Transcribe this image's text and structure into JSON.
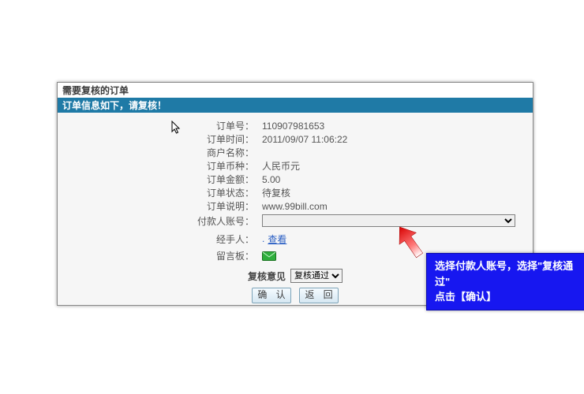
{
  "frame": {
    "title": "需要复核的订单",
    "banner": "订单信息如下，请复核！"
  },
  "fields": {
    "order_no_label": "订单号：",
    "order_no": "110907981653",
    "order_time_label": "订单时间：",
    "order_time": "2011/09/07 11:06:22",
    "merchant_label": "商户名称：",
    "merchant": "",
    "currency_label": "订单币种：",
    "currency": "人民币元",
    "amount_label": "订单金额：",
    "amount": "5.00",
    "status_label": "订单状态：",
    "status": "待复核",
    "desc_label": "订单说明：",
    "desc": "www.99bill.com",
    "payer_label": "付款人账号：",
    "payer_placeholder": "",
    "handler_label": "经手人：",
    "handler_link": "查看",
    "note_label": "留言板："
  },
  "footer": {
    "opinion_label": "复核意见",
    "opinion_selected": "复核通过",
    "confirm": "确 认",
    "back": "返 回"
  },
  "callout": {
    "line1": "选择付款人账号，选择\"复核通过\"",
    "line2": "点击【确认】"
  }
}
